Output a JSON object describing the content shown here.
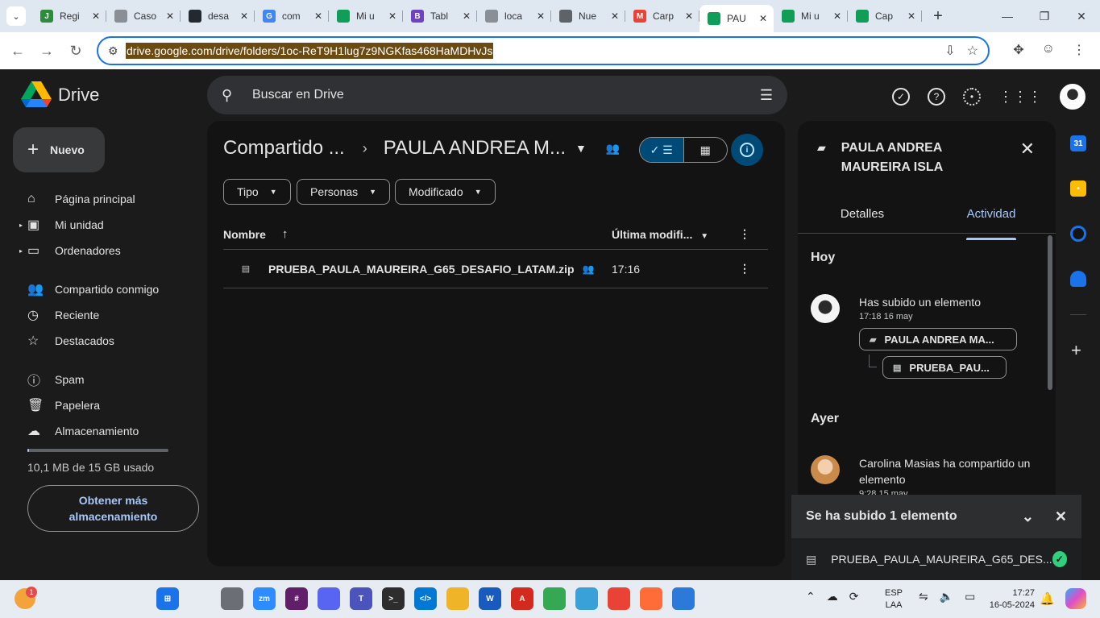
{
  "browser": {
    "tabs": [
      {
        "label": "Regi",
        "fav_color": "#2e8b3e",
        "fav_glyph": "J"
      },
      {
        "label": "Caso",
        "fav_color": "#8a8f95",
        "fav_glyph": ""
      },
      {
        "label": "desa",
        "fav_color": "#24292f",
        "fav_glyph": ""
      },
      {
        "label": "com",
        "fav_color": "#4285f4",
        "fav_glyph": "G"
      },
      {
        "label": "Mi u",
        "fav_color": "#0f9d58",
        "fav_glyph": ""
      },
      {
        "label": "Tabl",
        "fav_color": "#6f42c1",
        "fav_glyph": "B"
      },
      {
        "label": "loca",
        "fav_color": "#8a8f95",
        "fav_glyph": ""
      },
      {
        "label": "Nue",
        "fav_color": "#5f6368",
        "fav_glyph": ""
      },
      {
        "label": "Carp",
        "fav_color": "#ea4335",
        "fav_glyph": "M"
      },
      {
        "label": "PAU",
        "fav_color": "#0f9d58",
        "fav_glyph": "",
        "active": true
      },
      {
        "label": "Mi u",
        "fav_color": "#0f9d58",
        "fav_glyph": ""
      },
      {
        "label": "Cap",
        "fav_color": "#0f9d58",
        "fav_glyph": ""
      }
    ],
    "url": "drive.google.com/drive/folders/1oc-ReT9H1lug7z9NGKfas468HaMDHvJs"
  },
  "drive": {
    "logo_text": "Drive",
    "search_placeholder": "Buscar en Drive",
    "new_label": "Nuevo",
    "nav": [
      {
        "label": "Página principal",
        "icon": "home-icon",
        "glyph": "⌂",
        "caret": ""
      },
      {
        "label": "Mi unidad",
        "icon": "my-drive-icon",
        "glyph": "▣",
        "caret": "▸"
      },
      {
        "label": "Ordenadores",
        "icon": "computer-icon",
        "glyph": "▭",
        "caret": "▸"
      },
      {
        "label": "Compartido conmigo",
        "icon": "shared-icon",
        "glyph": "👥",
        "caret": ""
      },
      {
        "label": "Reciente",
        "icon": "clock-icon",
        "glyph": "◷",
        "caret": ""
      },
      {
        "label": "Destacados",
        "icon": "star-icon",
        "glyph": "☆",
        "caret": ""
      },
      {
        "label": "Spam",
        "icon": "spam-icon",
        "glyph": "ⓘ",
        "caret": ""
      },
      {
        "label": "Papelera",
        "icon": "trash-icon",
        "glyph": "🗑",
        "caret": ""
      },
      {
        "label": "Almacenamiento",
        "icon": "cloud-icon",
        "glyph": "☁",
        "caret": ""
      }
    ],
    "storage_used": "10,1 MB de 15 GB usado",
    "storage_fraction": 0.0007,
    "get_more_storage": "Obtener más almacenamiento"
  },
  "main": {
    "breadcrumb_parent": "Compartido ...",
    "breadcrumb_current": "PAULA ANDREA M...",
    "filters": [
      "Tipo",
      "Personas",
      "Modificado"
    ],
    "col_name": "Nombre",
    "col_modified": "Última modifi...",
    "files": [
      {
        "name": "PRUEBA_PAULA_MAUREIRA_G65_DESAFIO_LATAM.zip",
        "modified": "17:16"
      }
    ]
  },
  "panel": {
    "title": "PAULA ANDREA MAUREIRA ISLA",
    "tab_details": "Detalles",
    "tab_activity": "Actividad",
    "today": "Hoy",
    "yesterday": "Ayer",
    "act1_text": "Has subido un elemento",
    "act1_time": "17:18 16 may",
    "act1_folder": "PAULA ANDREA MA...",
    "act1_file": "PRUEBA_PAU...",
    "act2_text": "Carolina Masias ha compartido un elemento",
    "act2_time": "9:28 15 may"
  },
  "toast": {
    "title": "Se ha subido 1 elemento",
    "file": "PRUEBA_PAULA_MAUREIRA_G65_DES..."
  },
  "taskbar": {
    "weather_badge": "1",
    "apps": [
      {
        "name": "start-icon",
        "color": "#1a73e8",
        "glyph": "⊞"
      },
      {
        "name": "search-icon",
        "color": "#e7ecf3",
        "glyph": ""
      },
      {
        "name": "task-view-icon",
        "color": "#6b6f75",
        "glyph": ""
      },
      {
        "name": "zoom-icon",
        "color": "#2d8cff",
        "glyph": "zm"
      },
      {
        "name": "slack-icon",
        "color": "#611f69",
        "glyph": "#"
      },
      {
        "name": "discord-icon",
        "color": "#5865f2",
        "glyph": ""
      },
      {
        "name": "teams-icon",
        "color": "#4b53bc",
        "glyph": "T"
      },
      {
        "name": "terminal-icon",
        "color": "#2d2d2d",
        "glyph": ">_"
      },
      {
        "name": "vscode-icon",
        "color": "#0078d4",
        "glyph": "</>"
      },
      {
        "name": "explorer-icon",
        "color": "#f0b429",
        "glyph": ""
      },
      {
        "name": "word-icon",
        "color": "#185abd",
        "glyph": "W"
      },
      {
        "name": "acrobat-icon",
        "color": "#d42a1e",
        "glyph": "A"
      },
      {
        "name": "chrome-icon",
        "color": "#34a853",
        "glyph": ""
      },
      {
        "name": "notepad-icon",
        "color": "#3aa0d8",
        "glyph": ""
      },
      {
        "name": "chrome-profile-icon",
        "color": "#ea4335",
        "glyph": ""
      },
      {
        "name": "postman-icon",
        "color": "#ff6c37",
        "glyph": ""
      },
      {
        "name": "photos-icon",
        "color": "#2b79d8",
        "glyph": ""
      }
    ],
    "lang_top": "ESP",
    "lang_bottom": "LAA",
    "time": "17:27",
    "date": "16-05-2024"
  }
}
